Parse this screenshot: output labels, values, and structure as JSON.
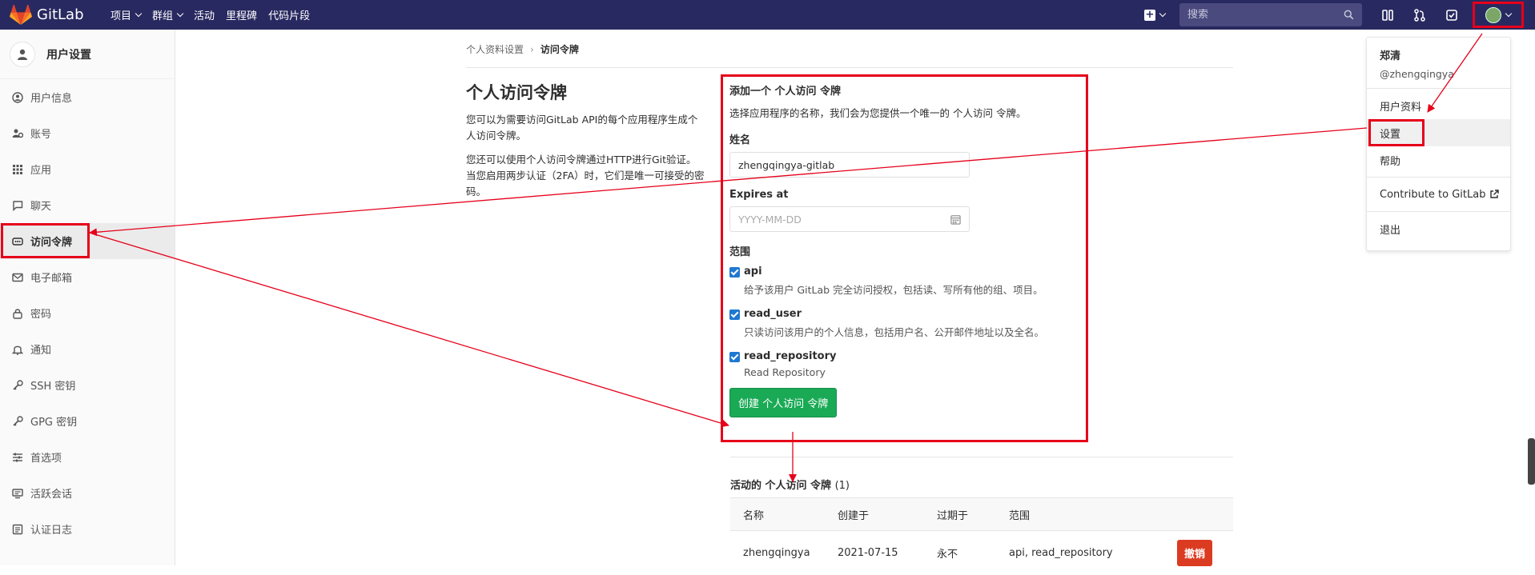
{
  "topbar": {
    "brand": "GitLab",
    "menu": [
      {
        "label": "项目",
        "has_caret": true
      },
      {
        "label": "群组",
        "has_caret": true
      },
      {
        "label": "活动",
        "has_caret": false
      },
      {
        "label": "里程碑",
        "has_caret": false
      },
      {
        "label": "代码片段",
        "has_caret": false
      }
    ],
    "search_placeholder": "搜索",
    "icons": [
      "plus-square-icon",
      "search-icon",
      "sidebar-toggle-icon",
      "merge-request-icon",
      "todo-check-icon",
      "user-avatar"
    ],
    "bg_color": "#292961"
  },
  "sidebar": {
    "title": "用户设置",
    "items": [
      {
        "label": "用户信息",
        "icon": "profile-icon",
        "active": false
      },
      {
        "label": "账号",
        "icon": "account-icon",
        "active": false
      },
      {
        "label": "应用",
        "icon": "applications-icon",
        "active": false
      },
      {
        "label": "聊天",
        "icon": "chat-icon",
        "active": false
      },
      {
        "label": "访问令牌",
        "icon": "token-icon",
        "active": true
      },
      {
        "label": "电子邮箱",
        "icon": "mail-icon",
        "active": false
      },
      {
        "label": "密码",
        "icon": "lock-icon",
        "active": false
      },
      {
        "label": "通知",
        "icon": "bell-icon",
        "active": false
      },
      {
        "label": "SSH 密钥",
        "icon": "key-icon",
        "active": false
      },
      {
        "label": "GPG 密钥",
        "icon": "key-icon",
        "active": false
      },
      {
        "label": "首选项",
        "icon": "preferences-icon",
        "active": false
      },
      {
        "label": "活跃会话",
        "icon": "sessions-icon",
        "active": false
      },
      {
        "label": "认证日志",
        "icon": "log-icon",
        "active": false
      }
    ]
  },
  "breadcrumb": {
    "parent": "个人资料设置",
    "current": "访问令牌"
  },
  "intro": {
    "title": "个人访问令牌",
    "p1": "您可以为需要访问GitLab API的每个应用程序生成个人访问令牌。",
    "p2": "您还可以使用个人访问令牌通过HTTP进行Git验证。 当您启用两步认证（2FA）时，它们是唯一可接受的密码。"
  },
  "form": {
    "heading": "添加一个 个人访问 令牌",
    "description": "选择应用程序的名称，我们会为您提供一个唯一的 个人访问 令牌。",
    "name_label": "姓名",
    "name_value": "zhengqingya-gitlab",
    "expires_label": "Expires at",
    "expires_placeholder": "YYYY-MM-DD",
    "scope_label": "范围",
    "scopes": [
      {
        "name": "api",
        "checked": true,
        "description": "给予该用户 GitLab 完全访问授权，包括读、写所有他的组、项目。"
      },
      {
        "name": "read_user",
        "checked": true,
        "description": "只读访问该用户的个人信息，包括用户名、公开邮件地址以及全名。"
      },
      {
        "name": "read_repository",
        "checked": true,
        "description": "Read Repository"
      }
    ],
    "submit_label": "创建 个人访问 令牌"
  },
  "active_tokens": {
    "title": "活动的 个人访问 令牌",
    "count": "(1)",
    "headers": [
      "名称",
      "创建于",
      "过期于",
      "范围"
    ],
    "rows": [
      {
        "name": "zhengqingya",
        "created": "2021-07-15",
        "expires": "永不",
        "scopes": "api, read_repository",
        "action": "撤销"
      }
    ]
  },
  "user_dropdown": {
    "name": "郑清",
    "username": "@zhengqingya",
    "items": [
      "用户资料",
      "设置",
      "帮助"
    ],
    "contribute": "Contribute to GitLab",
    "signout": "退出"
  },
  "annotation_color": "#e6001a"
}
